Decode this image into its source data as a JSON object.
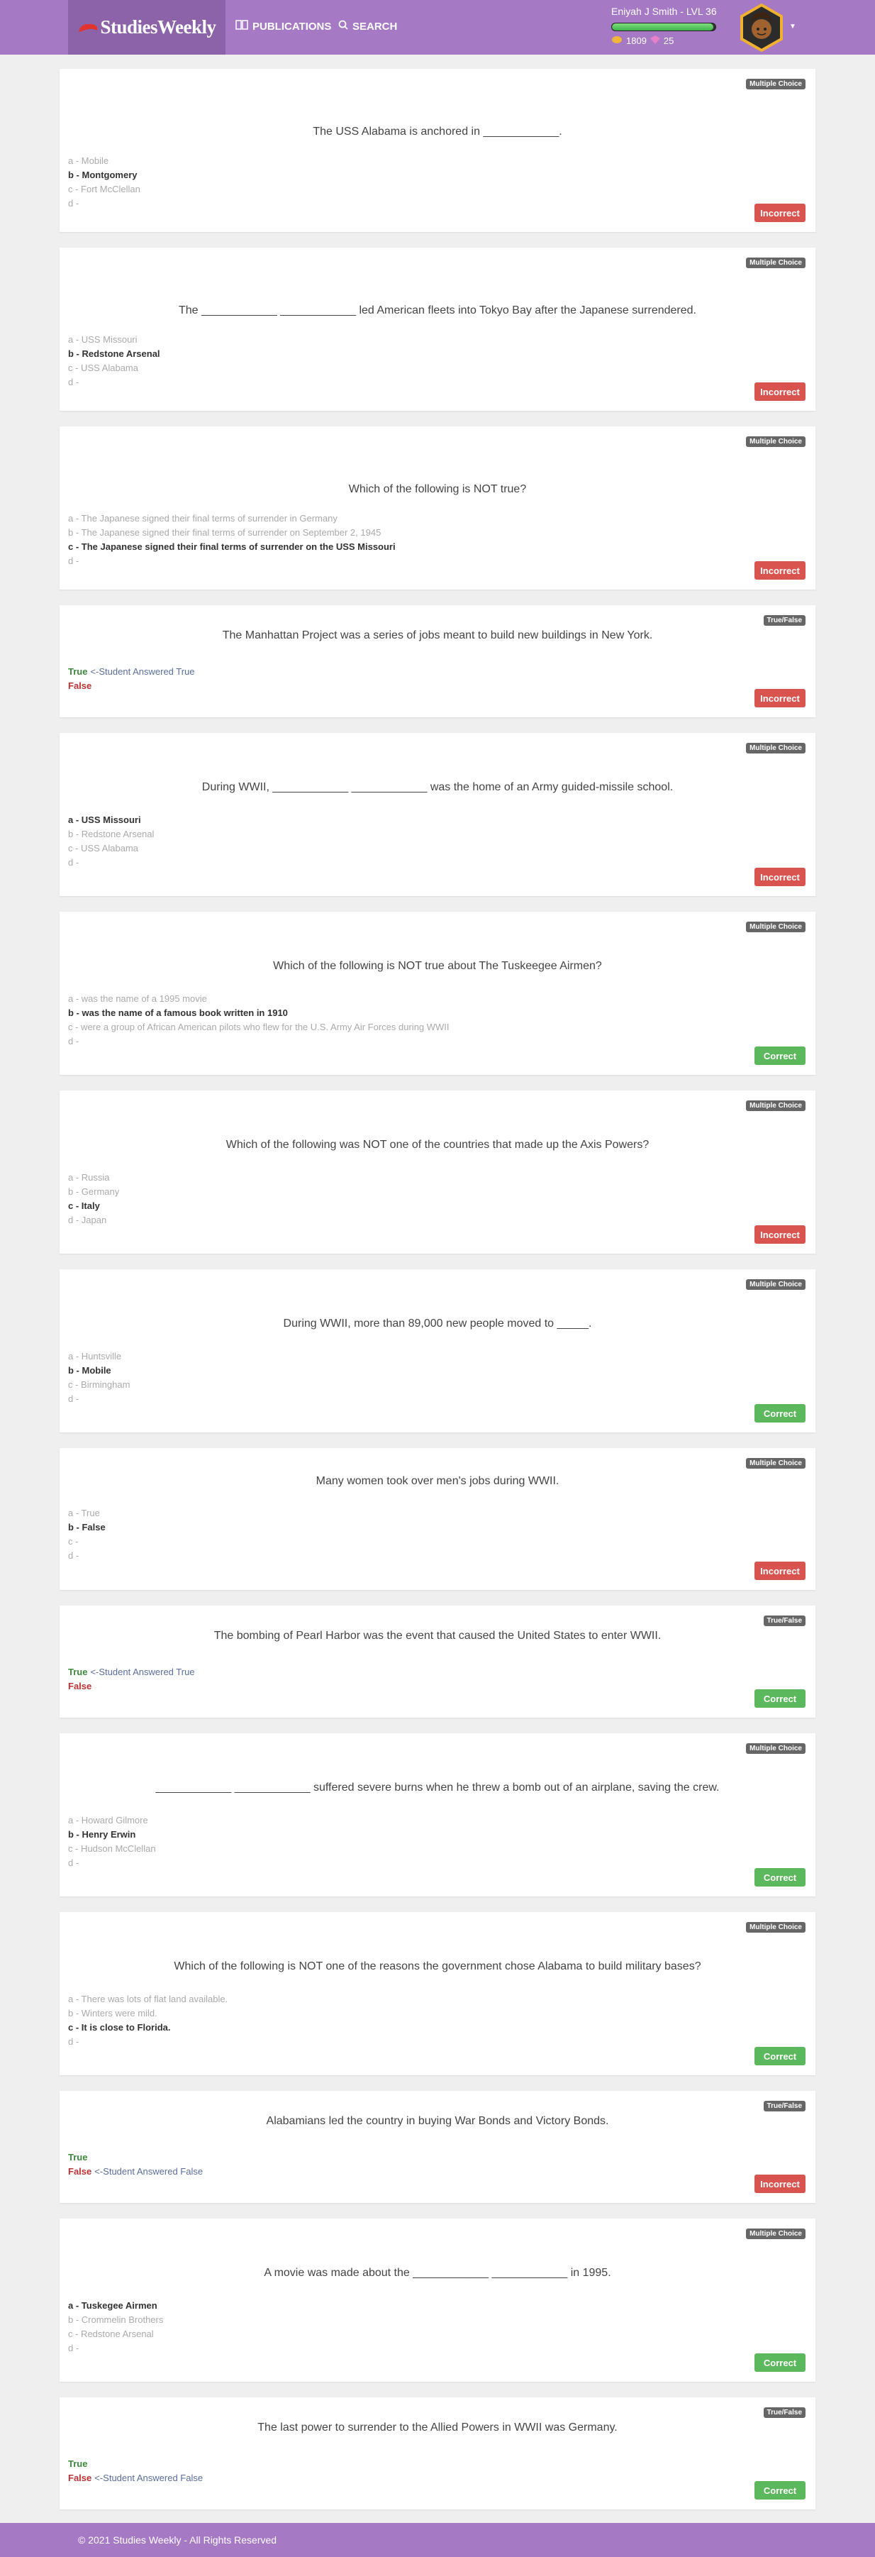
{
  "header": {
    "logo_text": "StudiesWeekly",
    "nav_publications": "PUBLICATIONS",
    "nav_search": "SEARCH",
    "user_label": "Eniyah J Smith - LVL 36",
    "xp_progress": 0.98,
    "coins": "1809",
    "gems": "25"
  },
  "questions": [
    {
      "type": "Multiple Choice",
      "text": "The USS Alabama is anchored in ____________.",
      "options": [
        "a - Mobile",
        "b - Montgomery",
        "c - Fort McClellan",
        "d -"
      ],
      "selected": 1,
      "result": "Incorrect"
    },
    {
      "type": "Multiple Choice",
      "text": "The ____________ ____________ led American fleets into Tokyo Bay after the Japanese surrendered.",
      "options": [
        "a - USS Missouri",
        "b - Redstone Arsenal",
        "c - USS Alabama",
        "d -"
      ],
      "selected": 1,
      "result": "Incorrect"
    },
    {
      "type": "Multiple Choice",
      "text": "Which of the following is NOT true?",
      "options": [
        "a - The Japanese signed their final terms of surrender in Germany",
        "b - The Japanese signed their final terms of surrender on September 2, 1945",
        "c - The Japanese signed their final terms of surrender on the USS Missouri",
        "d -"
      ],
      "selected": 2,
      "result": "Incorrect"
    },
    {
      "type": "True/False",
      "text": "The Manhattan Project was a series of jobs meant to build new buildings in New York.",
      "true_label": "True",
      "false_label": "False",
      "answered": "true",
      "note": "<-Student Answered True",
      "result": "Incorrect"
    },
    {
      "type": "Multiple Choice",
      "text": "During WWII, ____________ ____________ was the home of an Army guided-missile school.",
      "options": [
        "a - USS Missouri",
        "b - Redstone Arsenal",
        "c - USS Alabama",
        "d -"
      ],
      "selected": 0,
      "result": "Incorrect"
    },
    {
      "type": "Multiple Choice",
      "text": "Which of the following is NOT true about The Tuskeegee Airmen?",
      "options": [
        "a - was the name of a 1995 movie",
        "b - was the name of a famous book written in 1910",
        "c - were a group of African American pilots who flew for the U.S. Army Air Forces during WWII",
        "d -"
      ],
      "selected": 1,
      "result": "Correct"
    },
    {
      "type": "Multiple Choice",
      "text": "Which of the following was NOT one of the countries that made up the Axis Powers?",
      "options": [
        "a - Russia",
        "b - Germany",
        "c - Italy",
        "d - Japan"
      ],
      "selected": 2,
      "result": "Incorrect"
    },
    {
      "type": "Multiple Choice",
      "text": "During WWII, more than 89,000 new people moved to _____.",
      "options": [
        "a - Huntsville",
        "b - Mobile",
        "c - Birmingham",
        "d -"
      ],
      "selected": 1,
      "result": "Correct"
    },
    {
      "type": "Multiple Choice",
      "text": "Many women took over men's jobs during WWII.",
      "options": [
        "a - True",
        "b - False",
        "c -",
        "d -"
      ],
      "selected": 1,
      "result": "Incorrect"
    },
    {
      "type": "True/False",
      "text": "The bombing of Pearl Harbor was the event that caused the United States to enter WWII.",
      "true_label": "True",
      "false_label": "False",
      "answered": "true",
      "note": "<-Student Answered True",
      "result": "Correct"
    },
    {
      "type": "Multiple Choice",
      "text": "____________ ____________ suffered severe burns when he threw a bomb out of an airplane, saving the crew.",
      "options": [
        "a - Howard Gilmore",
        "b - Henry Erwin",
        "c - Hudson McClellan",
        "d -"
      ],
      "selected": 1,
      "result": "Correct"
    },
    {
      "type": "Multiple Choice",
      "text": "Which of the following is NOT one of the reasons the government chose Alabama to build military bases?",
      "options": [
        "a - There was lots of flat land available.",
        "b - Winters were mild.",
        "c - It is close to Florida.",
        "d -"
      ],
      "selected": 2,
      "result": "Correct"
    },
    {
      "type": "True/False",
      "text": "Alabamians led the country in buying War Bonds and Victory Bonds.",
      "true_label": "True",
      "false_label": "False",
      "answered": "false",
      "note": "<-Student Answered False",
      "result": "Incorrect"
    },
    {
      "type": "Multiple Choice",
      "text": "A movie was made about the ____________ ____________ in 1995.",
      "options": [
        "a - Tuskegee Airmen",
        "b - Crommelin Brothers",
        "c - Redstone Arsenal",
        "d -"
      ],
      "selected": 0,
      "result": "Correct"
    },
    {
      "type": "True/False",
      "text": "The last power to surrender to the Allied Powers in WWII was Germany.",
      "true_label": "True",
      "false_label": "False",
      "answered": "false",
      "note": "<-Student Answered False",
      "result": "Correct"
    }
  ],
  "footer": {
    "copyright": "© 2021 Studies Weekly - All Rights Reserved"
  },
  "colors": {
    "brand_purple": "#a679c4",
    "logo_purple": "#8c63a8",
    "incorrect": "#d9534f",
    "correct": "#5cb85c"
  }
}
